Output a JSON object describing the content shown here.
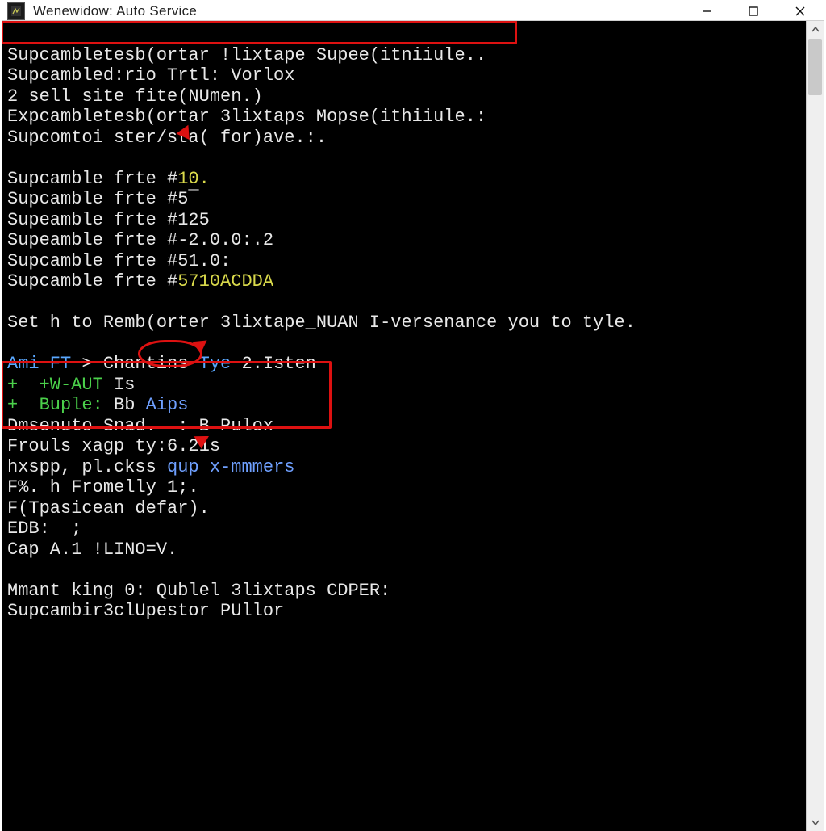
{
  "window": {
    "title": "Wenewidow: Auto Service"
  },
  "term": {
    "l0a": "Supcambletesb(ortar !lixtape Supee(itniiule..",
    "l1": "Supcambled:rio Trtl: Vorlox",
    "l2": "2 sell site fite(NUmen.)",
    "l3": "Expcambletesb(ortar 3lixtaps Mopse(ithiiule.:",
    "l4": "Supcomtoi ster/sta( for)ave.:.",
    "blank1": " ",
    "f1a": "Supcamble frte #",
    "f1b": "10.",
    "f2": "Supcamble frte #5¯",
    "f3": "Supeamble frte #125",
    "f4": "Supeamble frte #-2.0.0:.2",
    "f5": "Supcamble frte #51.0:",
    "f6a": "Supcamble frte #",
    "f6b": "5710ACDDA",
    "blank2": " ",
    "l5": "Set h to Remb(orter 3lixtape_NUAN I-versenance you to tyle.",
    "blank3": " ",
    "p1a": "Ami",
    "p1b": " FT ",
    "p1c": "> ",
    "p1d": "Chantins ",
    "p1e": "Tye ",
    "p1f": "2.Isten",
    "p2a": "+  +W-AUT ",
    "p2b": "Is",
    "p3a": "+  Buple: ",
    "p3b": "Bb ",
    "p3c": "Aips",
    "l6": "Dmsenuto Snad.  : B Pulox",
    "l7": "Frouls xagp ty:6.21s",
    "l8a": "hxspp, pl.ckss ",
    "l8b": "qup x-mmmers",
    "l9": "F%. h Fromelly 1;.",
    "l10": "F(Tpasicean defar).",
    "l11": "EDB:  ;",
    "l12": "Cap A.1 !LINO=V.",
    "blank4": " ",
    "l13": "Mmant king 0: Qublel 3lixtaps CDPER:",
    "l14": "Supcambir3clUpestor PUllor"
  }
}
